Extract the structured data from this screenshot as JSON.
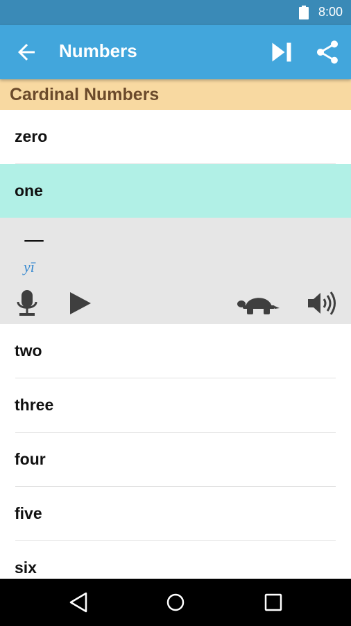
{
  "status_bar": {
    "time": "8:00"
  },
  "app_bar": {
    "title": "Numbers"
  },
  "section": {
    "title": "Cardinal Numbers"
  },
  "list": [
    {
      "label": "zero"
    },
    {
      "label": "one",
      "selected": true
    },
    {
      "label": "two"
    },
    {
      "label": "three"
    },
    {
      "label": "four"
    },
    {
      "label": "five"
    },
    {
      "label": "six"
    }
  ],
  "detail": {
    "character": "一",
    "pinyin": "yī"
  },
  "colors": {
    "status_bar": "#3a8ab7",
    "app_bar": "#42a6dc",
    "section_header": "#f8d9a1",
    "section_text": "#6b4a2b",
    "selected_row": "#b1f0e6",
    "detail_panel": "#e6e6e6",
    "pinyin": "#3b8bd0"
  },
  "icons": {
    "status": [
      "battery-icon"
    ],
    "app_bar": [
      "back-arrow-icon",
      "skip-next-icon",
      "share-icon"
    ],
    "detail": [
      "microphone-icon",
      "play-icon",
      "turtle-icon",
      "volume-icon"
    ],
    "nav": [
      "nav-back-icon",
      "nav-home-icon",
      "nav-recent-icon"
    ]
  }
}
